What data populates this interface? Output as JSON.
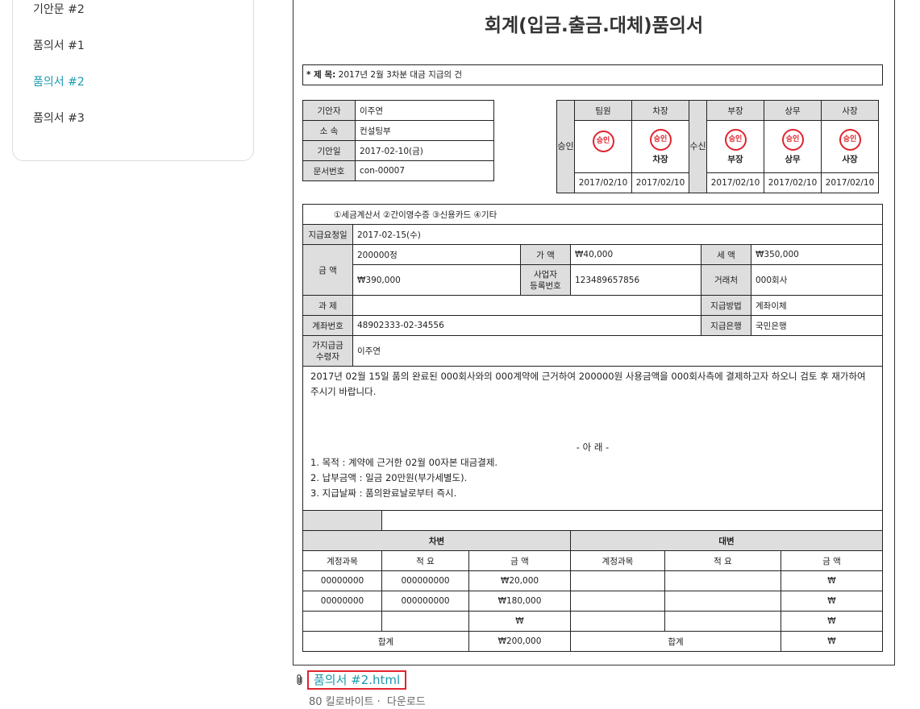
{
  "sidebar": {
    "items": [
      {
        "label": "기안문 #2"
      },
      {
        "label": "품의서 #1"
      },
      {
        "label": "품의서 #2",
        "active": true
      },
      {
        "label": "품의서 #3"
      }
    ]
  },
  "doc": {
    "title": "회계(입금.출금.대체)품의서",
    "subject_label": "* 제      목:",
    "subject_value": "2017년 2월 3차분 대금 지급의 건",
    "info": {
      "drafter_label": "기안자",
      "drafter": "이주연",
      "dept_label": "소 속",
      "dept": "컨설팅부",
      "date_label": "기안일",
      "date": "2017-02-10(금)",
      "docno_label": "문서번호",
      "docno": "con-00007"
    },
    "approval": {
      "left_label": "승인",
      "right_label": "수신",
      "stamp_text": "승인",
      "cols": [
        {
          "role": "팀원",
          "name": "",
          "date": "2017/02/10"
        },
        {
          "role": "차장",
          "name": "차장",
          "date": "2017/02/10"
        },
        {
          "role": "부장",
          "name": "부장",
          "date": "2017/02/10"
        },
        {
          "role": "상무",
          "name": "상무",
          "date": "2017/02/10"
        },
        {
          "role": "사장",
          "name": "사장",
          "date": "2017/02/10"
        }
      ]
    },
    "main": {
      "evidence": "①세금계산서 ②간이영수증 ③신용카드 ④기타",
      "req_date_label": "지급요청일",
      "req_date": "2017-02-15(수)",
      "amount_label": "금 액",
      "amount_words": "200000정",
      "amount_total": "₩390,000",
      "supply_label": "가 액",
      "supply": "₩40,000",
      "tax_label": "세 액",
      "tax": "₩350,000",
      "bizno_label": "사업자\n등록번호",
      "bizno": "123489657856",
      "vendor_label": "거래처",
      "vendor": "000회사",
      "subject_label": "과 제",
      "subject": "",
      "method_label": "지급방법",
      "method": "계좌이체",
      "account_label": "계좌번호",
      "account": "48902333-02-34556",
      "bank_label": "지급은행",
      "bank": "국민은행",
      "recipient_label": "가지급금\n수령자",
      "recipient": "이주연"
    },
    "body": {
      "paragraph": "2017년 02월 15일 품의 완료된 000회사와의 000계약에 근거하여 200000원 사용금액을 000회사측에 결제하고자 하오니 검토 후 재가하여 주시기 바랍니다.",
      "notice": "- 아      래 -",
      "lines": [
        "1. 목적 : 계약에 근거한 02월 00자본 대금결제.",
        "2. 납부금액 : 일금 20만원(부가세별도).",
        "3. 지급날짜 : 품의완료날로부터 즉시."
      ]
    },
    "ledger": {
      "debit_label": "차변",
      "credit_label": "대변",
      "col_account": "계정과목",
      "col_summary": "적 요",
      "col_amount": "금 액",
      "rows": [
        {
          "d_acc": "00000000",
          "d_sum": "000000000",
          "d_amt": "₩20,000",
          "c_acc": "",
          "c_sum": "",
          "c_amt": "₩"
        },
        {
          "d_acc": "00000000",
          "d_sum": "000000000",
          "d_amt": "₩180,000",
          "c_acc": "",
          "c_sum": "",
          "c_amt": "₩"
        },
        {
          "d_acc": "",
          "d_sum": "",
          "d_amt": "₩",
          "c_acc": "",
          "c_sum": "",
          "c_amt": "₩"
        }
      ],
      "total_label": "합계",
      "debit_total": "₩200,000",
      "credit_total": "₩"
    }
  },
  "attachment": {
    "icon": "paperclip-icon",
    "filename": "품의서 #2.html",
    "size": "80 킬로바이트",
    "separator": "·",
    "download_label": "다운로드"
  }
}
